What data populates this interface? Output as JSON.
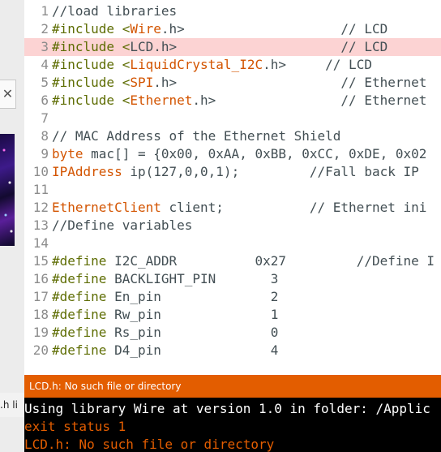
{
  "left_window": {
    "close_glyph": "✕",
    "filename_fragment": ".h li"
  },
  "editor": {
    "highlight_line": 3,
    "lines": [
      {
        "n": "1",
        "segments": [
          {
            "t": "//load libraries",
            "c": "cm"
          }
        ]
      },
      {
        "n": "2",
        "segments": [
          {
            "t": "#include <",
            "c": "kw"
          },
          {
            "t": "Wire",
            "c": "tp"
          },
          {
            "t": ".h>                    // LCD",
            "c": "cm"
          }
        ]
      },
      {
        "n": "3",
        "segments": [
          {
            "t": "#include <",
            "c": "kw"
          },
          {
            "t": "LCD.h>                     // LCD",
            "c": "cm"
          }
        ]
      },
      {
        "n": "4",
        "segments": [
          {
            "t": "#include <",
            "c": "kw"
          },
          {
            "t": "LiquidCrystal_I2C",
            "c": "tp"
          },
          {
            "t": ".h>     // LCD",
            "c": "cm"
          }
        ]
      },
      {
        "n": "5",
        "segments": [
          {
            "t": "#include <",
            "c": "kw"
          },
          {
            "t": "SPI",
            "c": "tp"
          },
          {
            "t": ".h>                     // Ethernet",
            "c": "cm"
          }
        ]
      },
      {
        "n": "6",
        "segments": [
          {
            "t": "#include <",
            "c": "kw"
          },
          {
            "t": "Ethernet",
            "c": "tp"
          },
          {
            "t": ".h>                // Ethernet",
            "c": "cm"
          }
        ]
      },
      {
        "n": "7",
        "segments": []
      },
      {
        "n": "8",
        "segments": [
          {
            "t": "// MAC Address of the Ethernet Shield",
            "c": "cm"
          }
        ]
      },
      {
        "n": "9",
        "segments": [
          {
            "t": "byte",
            "c": "tp"
          },
          {
            "t": " mac[] = {0x00, 0xAA, 0xBB, 0xCC, 0xDE, 0x02",
            "c": "cm"
          }
        ]
      },
      {
        "n": "10",
        "segments": [
          {
            "t": "IPAddress",
            "c": "tp"
          },
          {
            "t": " ip(127,0,0,1);         //Fall back IP",
            "c": "cm"
          }
        ]
      },
      {
        "n": "11",
        "segments": []
      },
      {
        "n": "12",
        "segments": [
          {
            "t": "EthernetClient",
            "c": "tp"
          },
          {
            "t": " client;           // Ethernet ini",
            "c": "cm"
          }
        ]
      },
      {
        "n": "13",
        "segments": [
          {
            "t": "//Define variables",
            "c": "cm"
          }
        ]
      },
      {
        "n": "14",
        "segments": []
      },
      {
        "n": "15",
        "segments": [
          {
            "t": "#define",
            "c": "kw"
          },
          {
            "t": " I2C_ADDR          0x27         //Define I",
            "c": "cm"
          }
        ]
      },
      {
        "n": "16",
        "segments": [
          {
            "t": "#define",
            "c": "kw"
          },
          {
            "t": " BACKLIGHT_PIN       3",
            "c": "cm"
          }
        ]
      },
      {
        "n": "17",
        "segments": [
          {
            "t": "#define",
            "c": "kw"
          },
          {
            "t": " En_pin              2",
            "c": "cm"
          }
        ]
      },
      {
        "n": "18",
        "segments": [
          {
            "t": "#define",
            "c": "kw"
          },
          {
            "t": " Rw_pin              1",
            "c": "cm"
          }
        ]
      },
      {
        "n": "19",
        "segments": [
          {
            "t": "#define",
            "c": "kw"
          },
          {
            "t": " Rs_pin              0",
            "c": "cm"
          }
        ]
      },
      {
        "n": "20",
        "segments": [
          {
            "t": "#define",
            "c": "kw"
          },
          {
            "t": " D4_pin              4",
            "c": "cm"
          }
        ]
      }
    ]
  },
  "status_bar": {
    "message": "LCD.h: No such file or directory"
  },
  "console": {
    "lines": [
      "Using library Wire at version 1.0 in folder: /Applic",
      "exit status 1",
      "LCD.h: No such file or directory"
    ]
  },
  "colors": {
    "status_bar": "#e35d00",
    "keyword": "#5e6d03",
    "type": "#d35400",
    "highlight": "#fcd3d3",
    "console_bg": "#000000"
  }
}
